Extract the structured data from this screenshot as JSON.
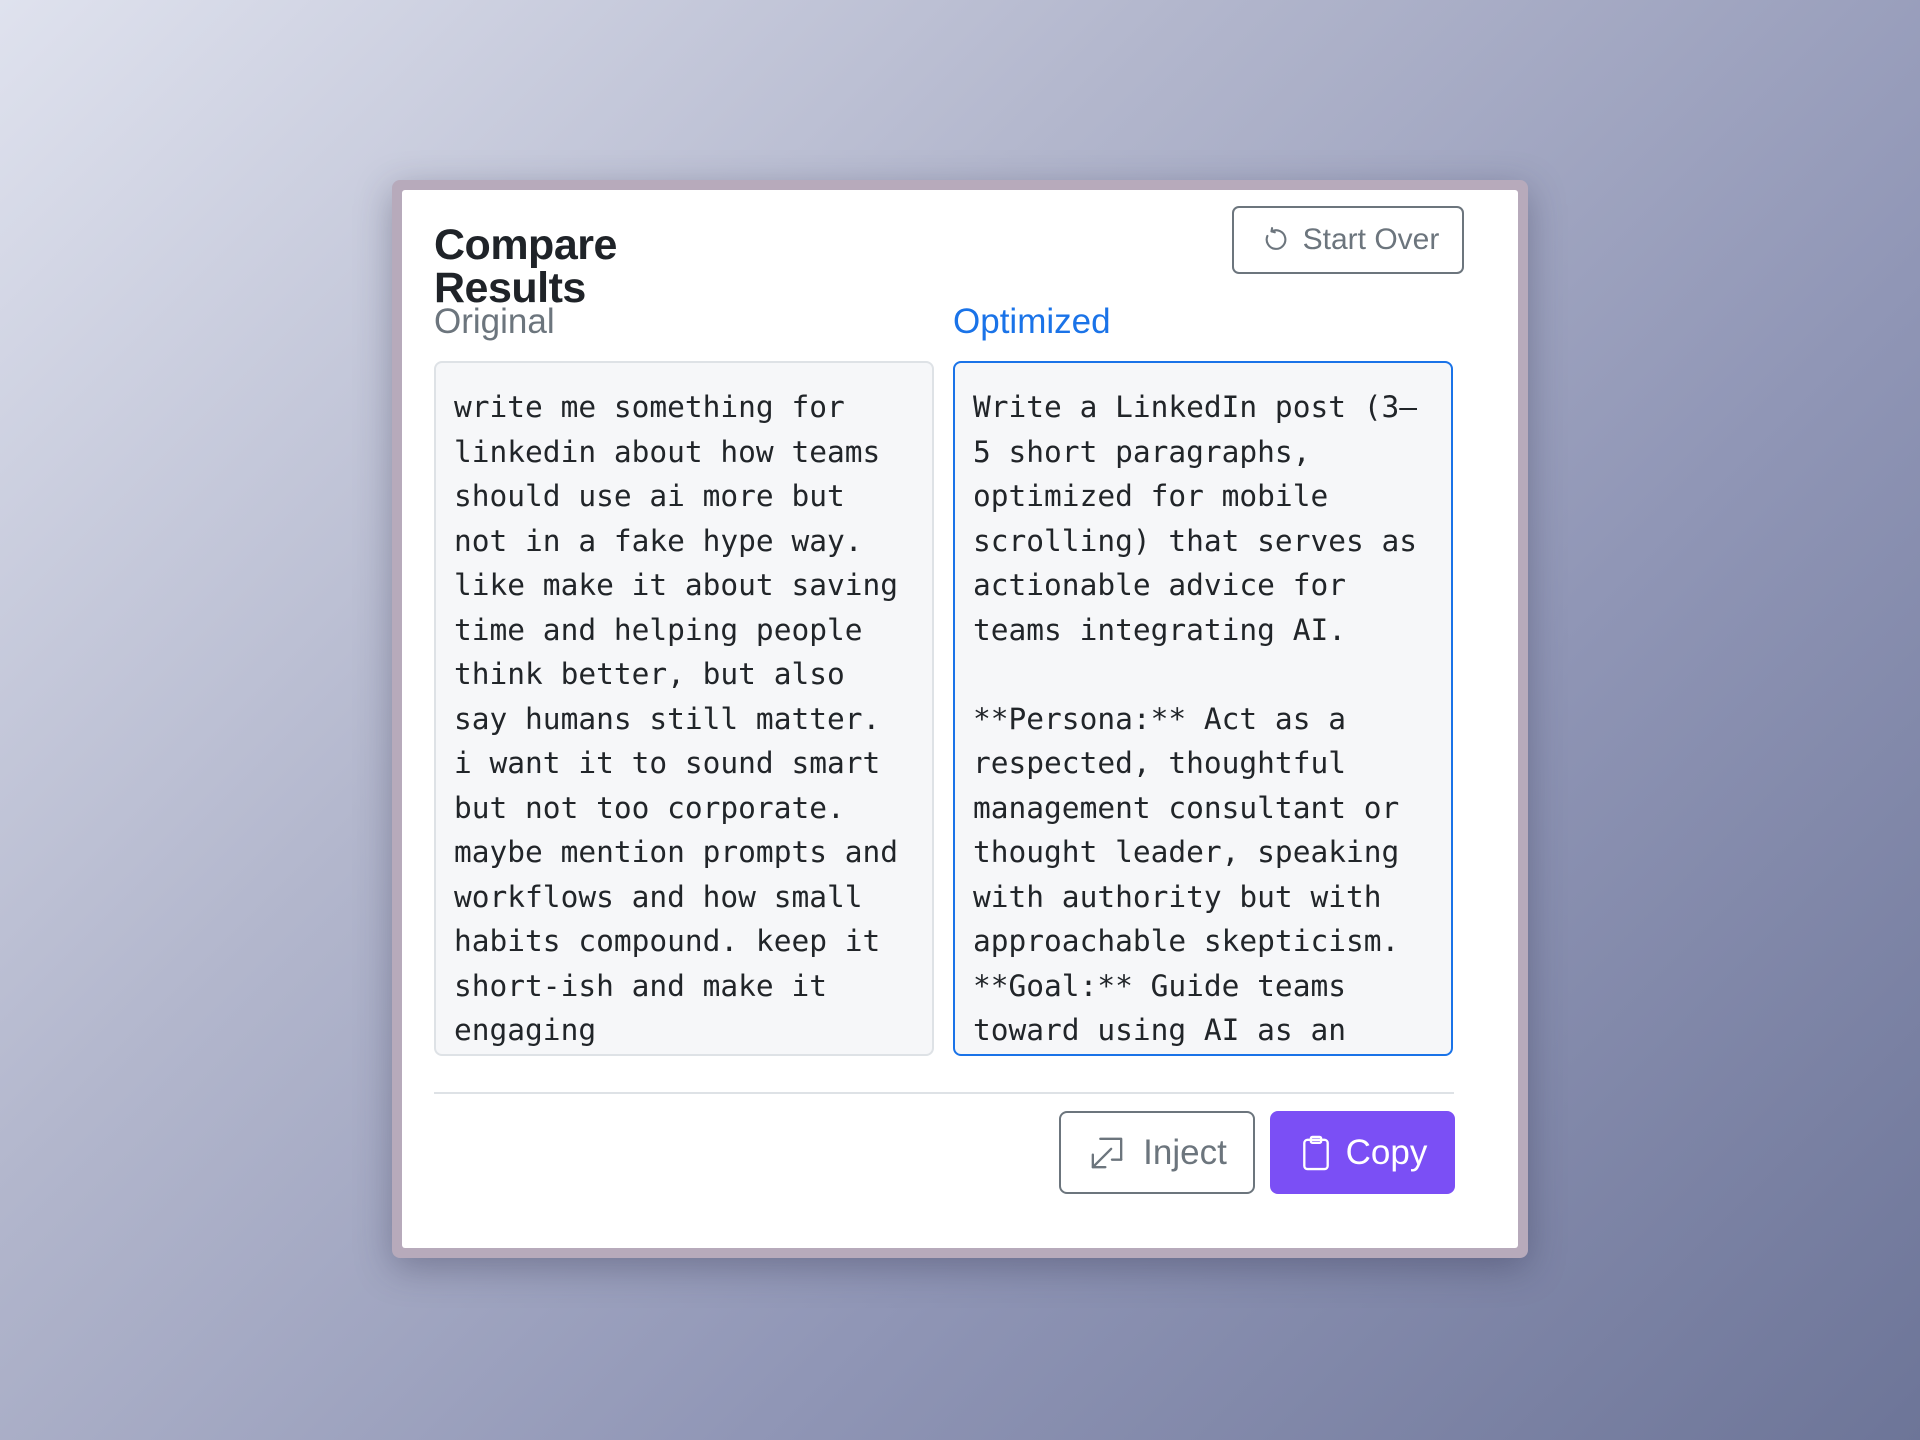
{
  "header": {
    "title": "Compare Results",
    "start_over_label": "Start Over",
    "start_over_icon": "refresh-icon"
  },
  "original": {
    "label": "Original",
    "text": "write me something for linkedin about how teams should use ai more but not in a fake hype way. like make it about saving time and helping people think better, but also say humans still matter. i want it to sound smart but not too corporate. maybe mention prompts and workflows and how small habits compound. keep it short-ish and make it engaging"
  },
  "optimized": {
    "label": "Optimized",
    "text": "Write a LinkedIn post (3–5 short paragraphs, optimized for mobile scrolling) that serves as actionable advice for teams integrating AI.\n\n**Persona:** Act as a respected, thoughtful management consultant or thought leader, speaking with authority but with approachable skepticism. **Goal:** Guide teams toward using AI as an"
  },
  "actions": {
    "inject_label": "Inject",
    "inject_icon": "inject-arrow-icon",
    "copy_label": "Copy",
    "copy_icon": "clipboard-icon"
  },
  "colors": {
    "accent_blue": "#1a73e8",
    "copy_button": "#7b4ff5",
    "secondary_gray": "#6c757d"
  }
}
